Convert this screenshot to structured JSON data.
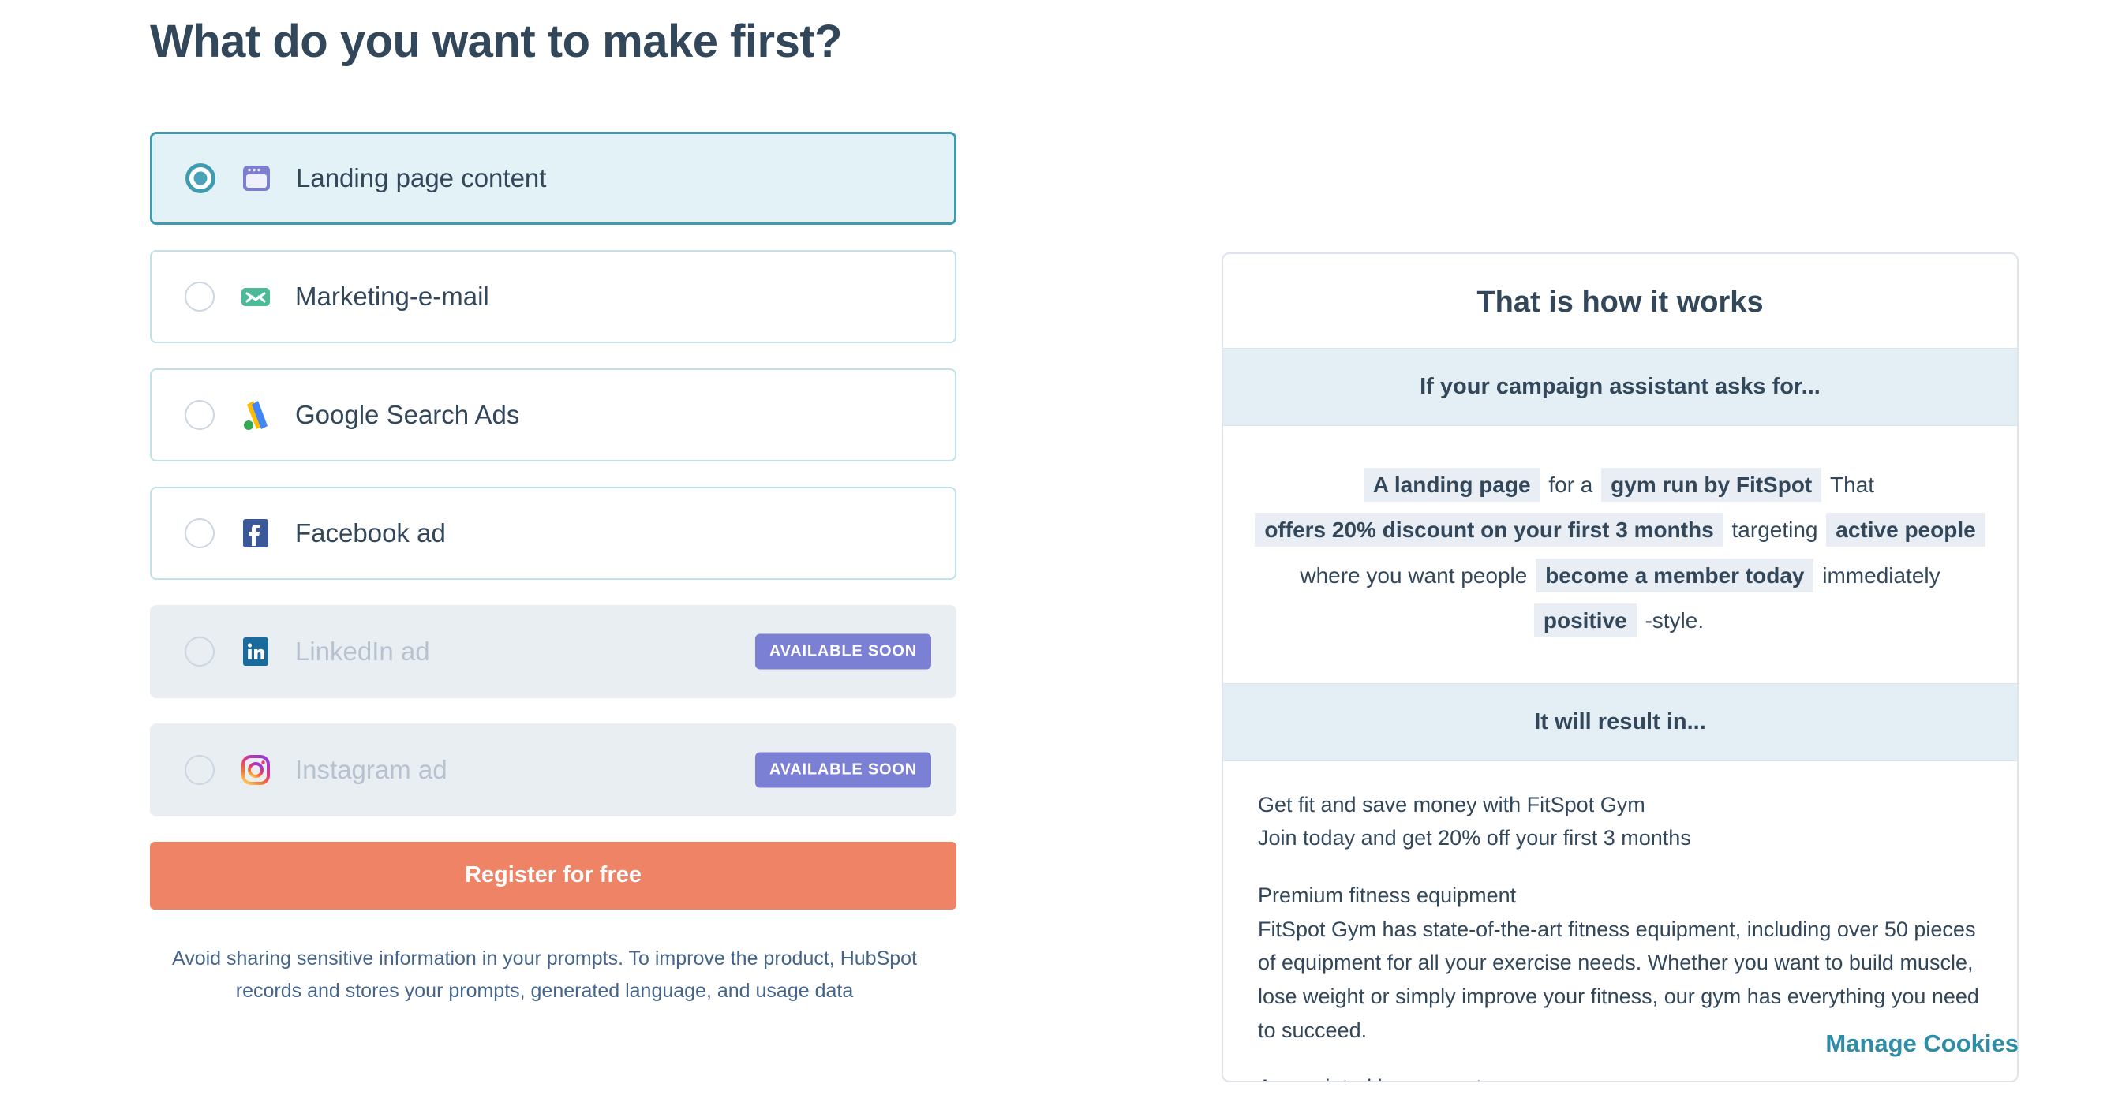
{
  "heading": "What do you want to make first?",
  "options": [
    {
      "label": "Landing page content",
      "icon": "browser-window-icon",
      "selected": true,
      "disabled": false,
      "badge": null
    },
    {
      "label": "Marketing-e-mail",
      "icon": "envelope-icon",
      "selected": false,
      "disabled": false,
      "badge": null
    },
    {
      "label": "Google Search Ads",
      "icon": "google-ads-icon",
      "selected": false,
      "disabled": false,
      "badge": null
    },
    {
      "label": "Facebook ad",
      "icon": "facebook-icon",
      "selected": false,
      "disabled": false,
      "badge": null
    },
    {
      "label": "LinkedIn ad",
      "icon": "linkedin-icon",
      "selected": false,
      "disabled": true,
      "badge": "AVAILABLE SOON"
    },
    {
      "label": "Instagram ad",
      "icon": "instagram-icon",
      "selected": false,
      "disabled": true,
      "badge": "AVAILABLE SOON"
    }
  ],
  "cta_label": "Register for free",
  "disclaimer": "Avoid sharing sensitive information in your prompts. To improve the product, HubSpot records and stores your prompts, generated language, and usage data",
  "panel": {
    "title": "That is how it works",
    "ask_band": "If your campaign assistant asks for...",
    "prompt_tokens": [
      {
        "text": "A landing page",
        "bold": true
      },
      {
        "text": "for a",
        "bold": false
      },
      {
        "text": "gym run by FitSpot",
        "bold": true
      },
      {
        "text": "That",
        "bold": false
      },
      {
        "text": "offers 20% discount on your first 3 months",
        "bold": true
      },
      {
        "text": "targeting",
        "bold": false
      },
      {
        "text": "active people",
        "bold": true
      },
      {
        "text": "where you want people",
        "bold": false
      },
      {
        "text": "become a member today",
        "bold": true
      },
      {
        "text": "immediately",
        "bold": false
      },
      {
        "text": "positive",
        "bold": true
      },
      {
        "text": "-style.",
        "bold": false
      }
    ],
    "result_band": "It will result in...",
    "result_paragraphs": [
      "Get fit and save money with FitSpot Gym\nJoin today and get 20% off your first 3 months",
      "Premium fitness equipment\nFitSpot Gym has state-of-the-art fitness equipment, including over 50 pieces of equipment for all your exercise needs. Whether you want to build muscle, lose weight or simply improve your fitness, our gym has everything you need to succeed.",
      "Appreciated by our customers"
    ]
  },
  "manage_cookies": "Manage Cookies",
  "colors": {
    "heading": "#33475b",
    "selected_border": "#3f9cb0",
    "selected_fill": "#e3f2f6",
    "cta": "#ee8366",
    "badge": "#7b80d4",
    "band": "#e4eff5",
    "link": "#2e8ca6"
  }
}
